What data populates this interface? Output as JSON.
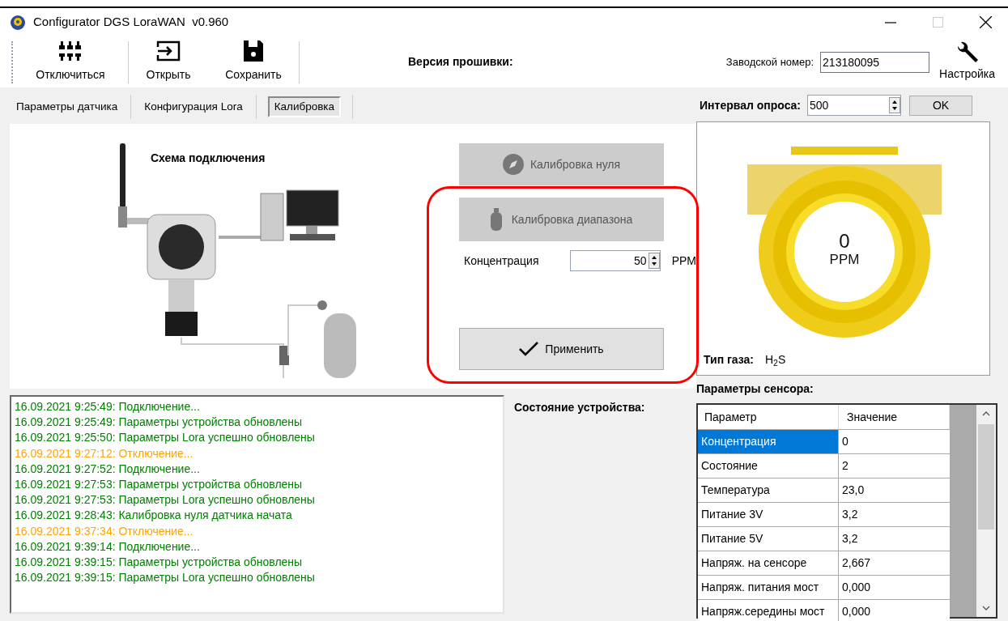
{
  "window": {
    "title": "Configurator DGS LoraWAN  v0.960"
  },
  "toolbar": {
    "buttons": [
      {
        "kind": "disconnect",
        "label": "Отключиться"
      },
      {
        "kind": "open",
        "label": "Открыть"
      },
      {
        "kind": "save",
        "label": "Сохранить"
      }
    ],
    "firmware_label": "Версия прошивки:",
    "serial_label": "Заводской номер:",
    "serial_value": "213180095",
    "settings_label": "Настройка"
  },
  "tabs": [
    {
      "label": "Параметры датчика",
      "selected": false
    },
    {
      "label": "Конфигурация Lora",
      "selected": false
    },
    {
      "label": "Калибровка",
      "selected": true
    }
  ],
  "calibration": {
    "diagram_title": "Схема подключения",
    "zero_button": "Калибровка нуля",
    "span_button": "Калибровка диапазона",
    "concentration_label": "Концентрация",
    "concentration_value": "50",
    "unit": "PPM",
    "apply_button": "Применить"
  },
  "log": [
    {
      "text": "16.09.2021 9:25:49: Подключение...",
      "color": "#008000"
    },
    {
      "text": "16.09.2021 9:25:49: Параметры устройства обновлены",
      "color": "#008000"
    },
    {
      "text": "16.09.2021 9:25:50: Параметры Lora успешно обновлены",
      "color": "#008000"
    },
    {
      "text": "16.09.2021 9:27:12: Отключение...",
      "color": "#ffa500"
    },
    {
      "text": "16.09.2021 9:27:52: Подключение...",
      "color": "#008000"
    },
    {
      "text": "16.09.2021 9:27:53: Параметры устройства обновлены",
      "color": "#008000"
    },
    {
      "text": "16.09.2021 9:27:53: Параметры Lora успешно обновлены",
      "color": "#008000"
    },
    {
      "text": "16.09.2021 9:28:43: Калибровка нуля датчика начата",
      "color": "#008000"
    },
    {
      "text": "16.09.2021 9:37:34: Отключение...",
      "color": "#ffa500"
    },
    {
      "text": "16.09.2021 9:39:14: Подключение...",
      "color": "#008000"
    },
    {
      "text": "16.09.2021 9:39:15: Параметры устройства обновлены",
      "color": "#008000"
    },
    {
      "text": "16.09.2021 9:39:15: Параметры Lora успешно обновлены",
      "color": "#008000"
    }
  ],
  "device_state_label": "Состояние устройства:",
  "poll": {
    "label": "Интервал опроса:",
    "value": "500",
    "ok_button": "OK"
  },
  "gauge": {
    "value": "0",
    "unit": "PPM",
    "gas_label": "Тип газа:",
    "gas_value": "H$_{2}$S"
  },
  "sensor_params": {
    "title": "Параметры сенсора:",
    "columns": [
      "Параметр",
      "Значение"
    ],
    "rows": [
      {
        "name": "Концентрация",
        "value": "0",
        "selected": true
      },
      {
        "name": "Состояние",
        "value": "2",
        "selected": false
      },
      {
        "name": "Температура",
        "value": "23,0",
        "selected": false
      },
      {
        "name": "Питание 3V",
        "value": "3,2",
        "selected": false
      },
      {
        "name": "Питание 5V",
        "value": "3,2",
        "selected": false
      },
      {
        "name": "Напряж. на сенсоре",
        "value": "2,667",
        "selected": false
      },
      {
        "name": "Напряж. питания мост",
        "value": "0,000",
        "selected": false
      },
      {
        "name": "Напряж.середины мост",
        "value": "0,000",
        "selected": false
      }
    ]
  }
}
